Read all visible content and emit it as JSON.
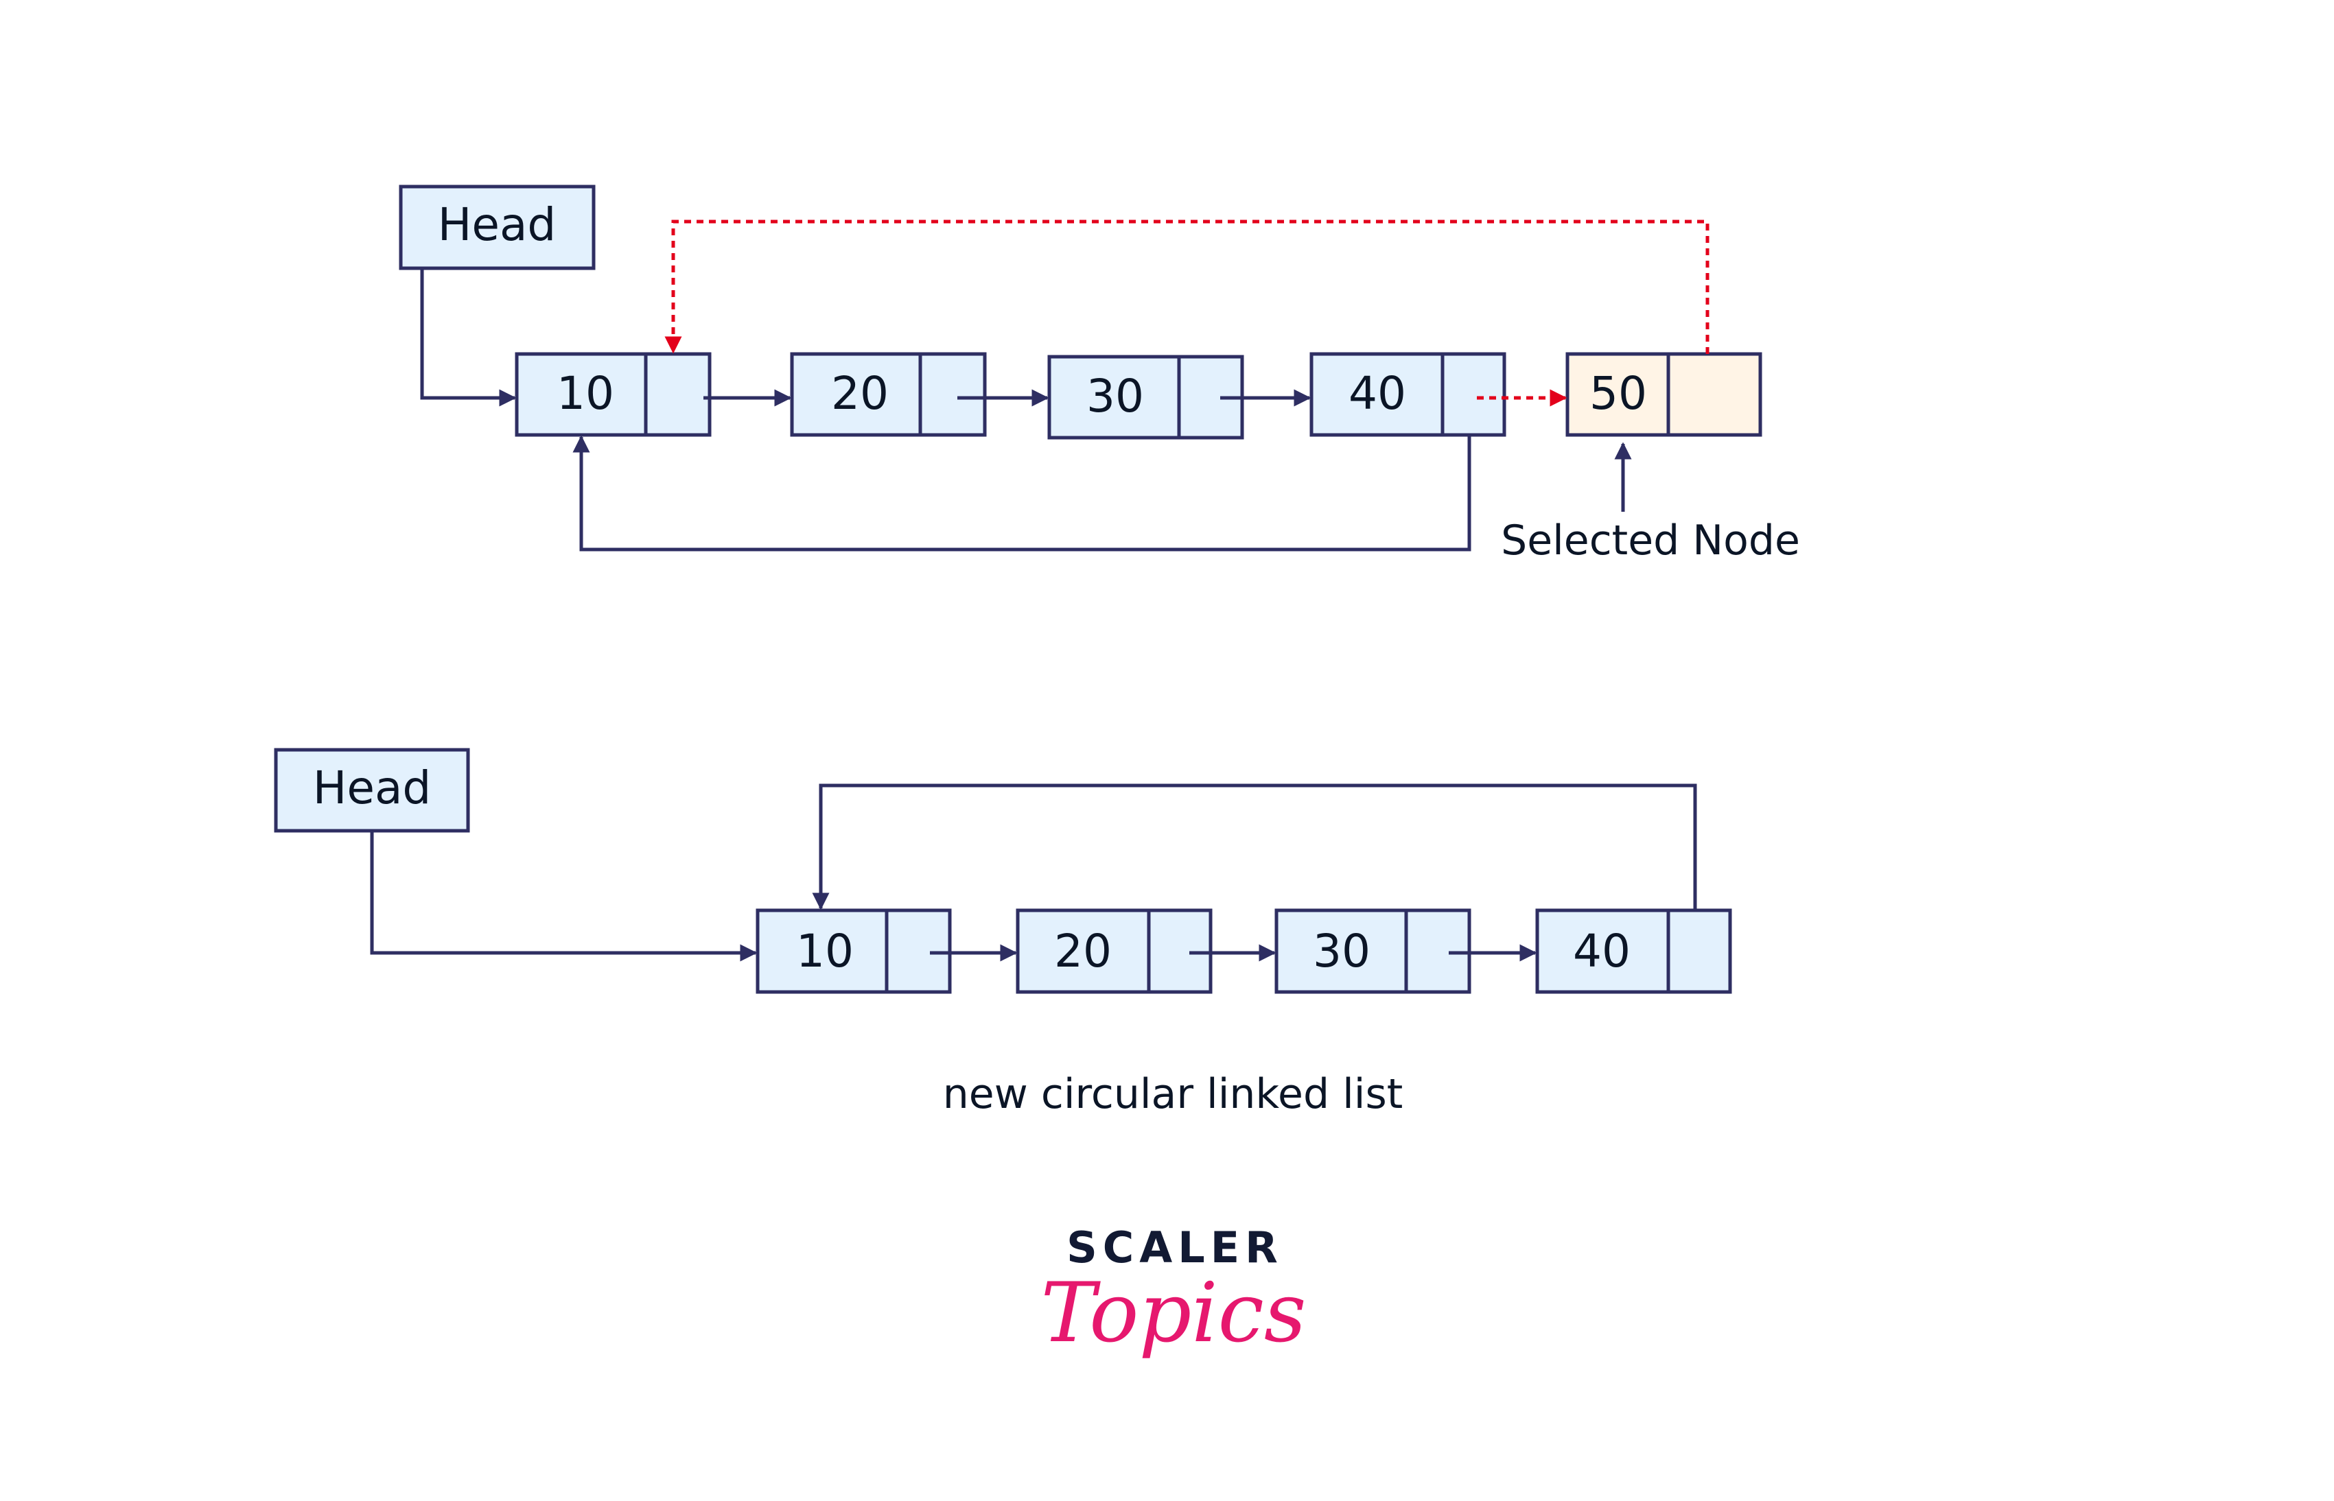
{
  "colors": {
    "node_fill": "#e3f1fd",
    "selected_fill": "#fff4e6",
    "stroke": "#2e2e62",
    "new_link": "#e3001b",
    "text": "#0b1526",
    "logo_dark": "#121a33",
    "logo_pink": "#e6186e"
  },
  "top_diagram": {
    "head_label": "Head",
    "nodes": [
      {
        "value": "10",
        "selected": false
      },
      {
        "value": "20",
        "selected": false
      },
      {
        "value": "30",
        "selected": false
      },
      {
        "value": "40",
        "selected": false
      },
      {
        "value": "50",
        "selected": true
      }
    ],
    "selected_label": "Selected Node"
  },
  "bottom_diagram": {
    "head_label": "Head",
    "nodes": [
      {
        "value": "10"
      },
      {
        "value": "20"
      },
      {
        "value": "30"
      },
      {
        "value": "40"
      }
    ],
    "caption": "new circular linked list"
  },
  "logo": {
    "line1": "SCALER",
    "line2": "Topics"
  }
}
